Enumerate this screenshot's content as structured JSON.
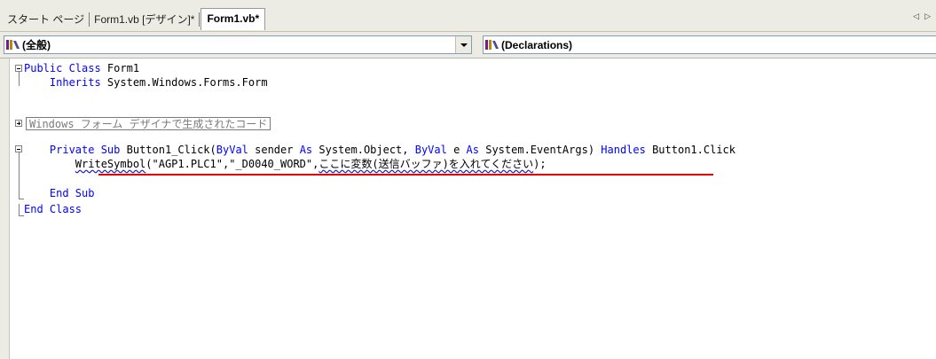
{
  "tabs": [
    {
      "label": "スタート ページ",
      "active": false
    },
    {
      "label": "Form1.vb [デザイン]*",
      "active": false
    },
    {
      "label": "Form1.vb*",
      "active": true
    }
  ],
  "tab_scroll": {
    "left": "◁",
    "right": "▷"
  },
  "class_combo": {
    "icon": "class-icon",
    "value": "(全般)"
  },
  "method_combo": {
    "icon": "class-icon",
    "value": "(Declarations)"
  },
  "code": {
    "line1": {
      "kw": "Public Class",
      "rest": " Form1"
    },
    "line2": {
      "indent": "    ",
      "kw": "Inherits",
      "rest": " System.Windows.Forms.Form"
    },
    "region": "Windows フォーム デザイナで生成されたコード",
    "line4": {
      "indent": "    ",
      "kw1": "Private Sub",
      "t1": " Button1_Click(",
      "kw2": "ByVal",
      "t2": " sender ",
      "kw3": "As",
      "t3": " System.Object, ",
      "kw4": "ByVal",
      "t4": " e ",
      "kw5": "As",
      "t5": " System.EventArgs) ",
      "kw6": "Handles",
      "t6": " Button1.Click"
    },
    "line5": {
      "indent": "        ",
      "fn": "WriteSymbol",
      "args": "(\"AGP1.PLC1\",\"_D0040_WORD\",",
      "placeholder": "ここに変数(送信バッファ)を入れてください",
      "end": ");"
    },
    "line6": {
      "indent": "    ",
      "kw": "End Sub"
    },
    "line7": {
      "kw": "End Class"
    }
  },
  "colors": {
    "keyword": "#0000ff",
    "highlight_underline": "#e00000",
    "squiggle": "#2020c0"
  }
}
